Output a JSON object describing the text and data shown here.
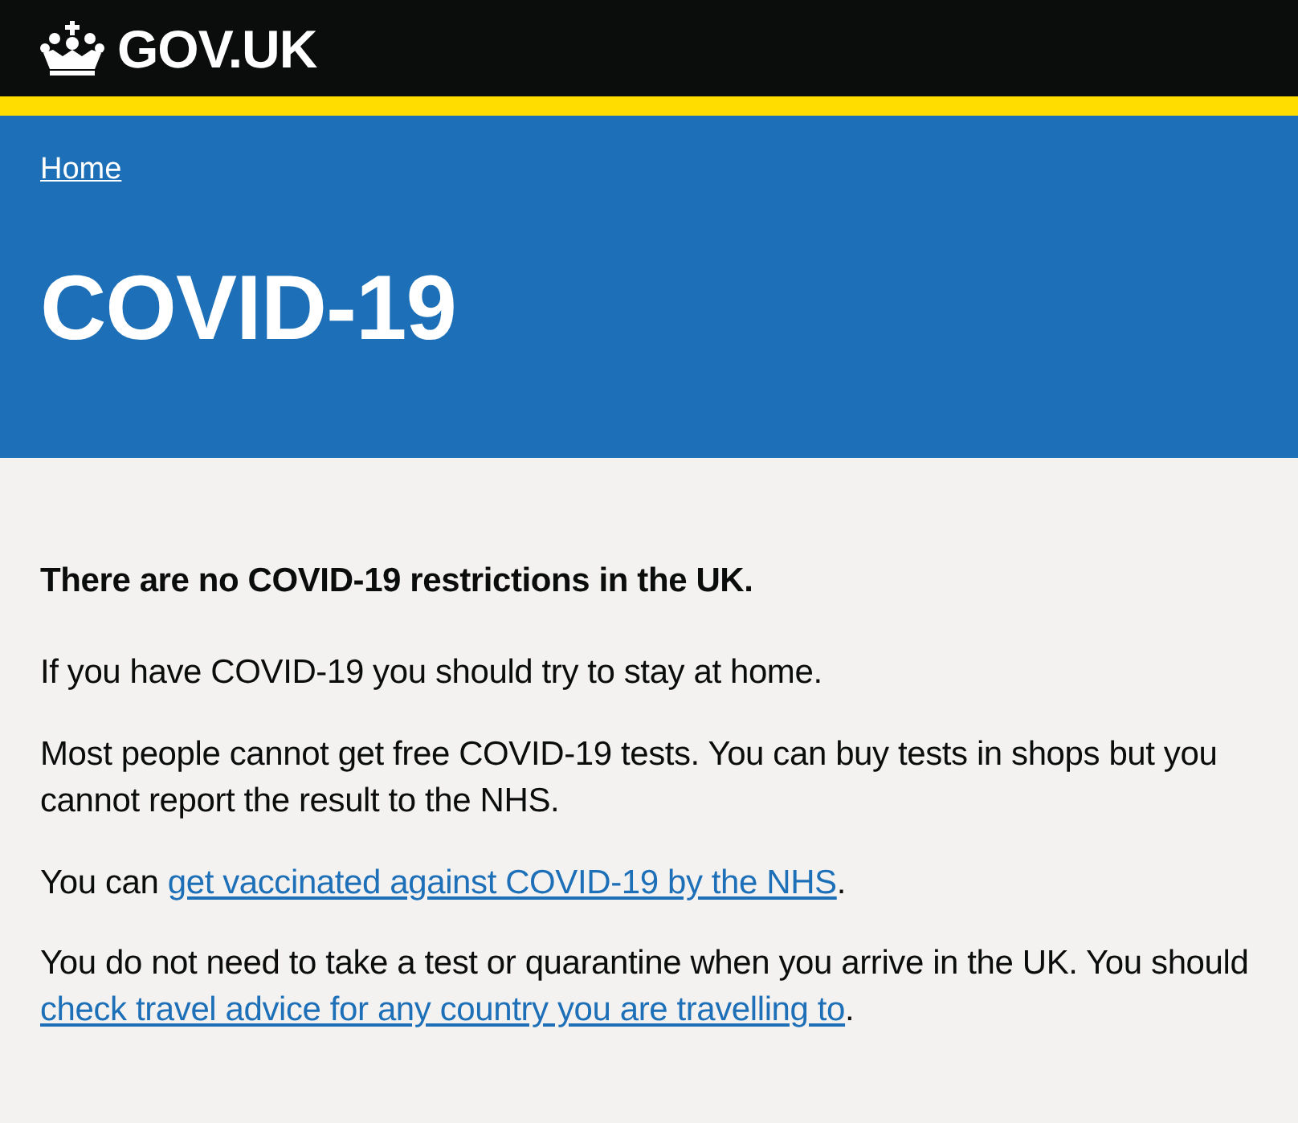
{
  "header": {
    "logo": "GOV.UK"
  },
  "breadcrumb": {
    "label": "Home"
  },
  "title": "COVID-19",
  "paragraphs": [
    {
      "bold": true,
      "parts": [
        {
          "kind": "text",
          "text": "There are no COVID-19 restrictions in the UK."
        }
      ]
    },
    {
      "bold": false,
      "parts": [
        {
          "kind": "text",
          "text": "If you have COVID-19 you should try to stay at home."
        }
      ]
    },
    {
      "bold": false,
      "parts": [
        {
          "kind": "text",
          "text": "Most people cannot get free COVID-19 tests. You can buy tests in shops but you cannot report the result to the NHS."
        }
      ]
    },
    {
      "bold": false,
      "parts": [
        {
          "kind": "text",
          "text": "You can "
        },
        {
          "kind": "link",
          "text": "get vaccinated against COVID-19 by the NHS"
        },
        {
          "kind": "text",
          "text": "."
        }
      ]
    },
    {
      "bold": false,
      "parts": [
        {
          "kind": "text",
          "text": "You do not need to take a test or quarantine when you arrive in the UK. You should "
        },
        {
          "kind": "link",
          "text": "check travel advice for any country you are travelling to"
        },
        {
          "kind": "text",
          "text": "."
        }
      ]
    }
  ]
}
